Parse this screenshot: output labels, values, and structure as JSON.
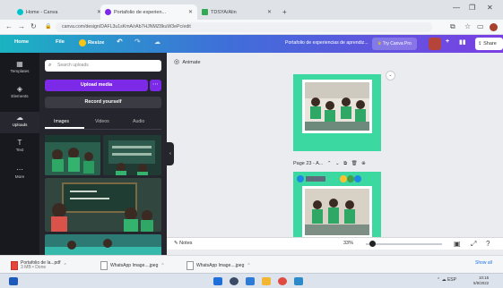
{
  "browser": {
    "tabs": [
      {
        "label": "Home - Canva",
        "favicon_color": "#00c4cc",
        "active": false
      },
      {
        "label": "Portafolio de experien...",
        "favicon_color": "#7d2ae8",
        "active": true
      },
      {
        "label": "TDSYA/Alin",
        "favicon_color": "#34a853",
        "active": false
      }
    ],
    "new_tab_label": "+",
    "url": "canva.com/design/DAFL3u1sKmA/rAb7HJNMZ8kuW3ePc/edit"
  },
  "canva": {
    "header": {
      "home": "Home",
      "file": "File",
      "resize": "Resize",
      "document_title": "Portafolio de experiencias de aprendiz...",
      "try_pro": "Try Canva Pro",
      "add_label": "+",
      "share": "Share"
    },
    "rail": [
      {
        "icon": "templates-icon",
        "glyph": "▦",
        "label": "Templates"
      },
      {
        "icon": "elements-icon",
        "glyph": "◈",
        "label": "Elements"
      },
      {
        "icon": "uploads-icon",
        "glyph": "☁",
        "label": "Uploads",
        "active": true
      },
      {
        "icon": "text-icon",
        "glyph": "T",
        "label": "Text"
      },
      {
        "icon": "more-icon",
        "glyph": "⋯",
        "label": "More"
      }
    ],
    "panel": {
      "search_placeholder": "Search uploads",
      "upload_label": "Upload media",
      "upload_more": "⋯",
      "record_label": "Record yourself",
      "tabs": [
        {
          "label": "Images",
          "active": true
        },
        {
          "label": "Videos",
          "active": false
        },
        {
          "label": "Audio",
          "active": false
        }
      ]
    },
    "canvas": {
      "animate_label": "Animate",
      "page2_label": "Page 23 - A...",
      "notes_label": "Notes",
      "zoom": "33%",
      "zoom_fraction": 0.33
    }
  },
  "downloads": {
    "items": [
      {
        "name": "Portafolio de la...pdf",
        "sub": "3 MB • Done",
        "type": "pdf"
      },
      {
        "name": "WhatsApp Image....jpeg",
        "sub": "",
        "type": "img"
      },
      {
        "name": "WhatsApp Image....jpeg",
        "sub": "",
        "type": "img"
      }
    ],
    "show_all": "Show all"
  },
  "taskbar": {
    "lang": "ESP",
    "time": "10:15",
    "date": "5/9/2022"
  }
}
